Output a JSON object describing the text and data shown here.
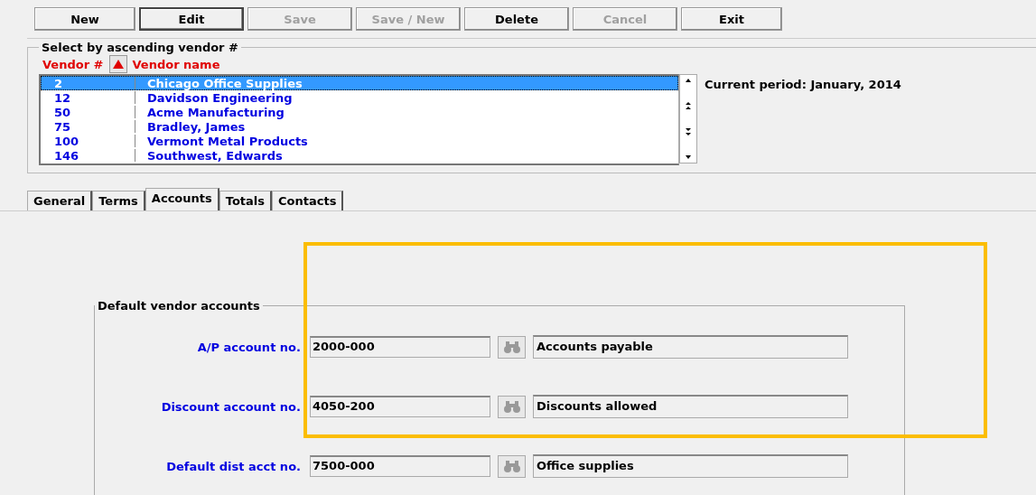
{
  "toolbar": [
    {
      "label": "New",
      "disabled": false,
      "selected": false
    },
    {
      "label": "Edit",
      "disabled": false,
      "selected": true
    },
    {
      "label": "Save",
      "disabled": true,
      "selected": false
    },
    {
      "label": "Save / New",
      "disabled": true,
      "selected": false
    },
    {
      "label": "Delete",
      "disabled": false,
      "selected": false
    },
    {
      "label": "Cancel",
      "disabled": true,
      "selected": false
    },
    {
      "label": "Exit",
      "disabled": false,
      "selected": false
    }
  ],
  "vendor_list": {
    "title": "Select by ascending vendor #",
    "columns": [
      "Vendor #",
      "Vendor name"
    ],
    "rows": [
      {
        "number": "2",
        "name": "Chicago Office Supplies",
        "selected": true
      },
      {
        "number": "12",
        "name": "Davidson Engineering",
        "selected": false
      },
      {
        "number": "50",
        "name": "Acme Manufacturing",
        "selected": false
      },
      {
        "number": "75",
        "name": "Bradley, James",
        "selected": false
      },
      {
        "number": "100",
        "name": "Vermont Metal Products",
        "selected": false
      },
      {
        "number": "146",
        "name": "Southwest, Edwards",
        "selected": false
      }
    ]
  },
  "current_period": "Current period: January, 2014",
  "tabs": [
    {
      "label": "General",
      "selected": false
    },
    {
      "label": "Terms",
      "selected": false
    },
    {
      "label": "Accounts",
      "selected": true
    },
    {
      "label": "Totals",
      "selected": false
    },
    {
      "label": "Contacts",
      "selected": false
    }
  ],
  "accounts_group": {
    "title": "Default  vendor accounts",
    "rows": [
      {
        "label": "A/P account no.",
        "value": "2000-000",
        "description": "Accounts payable"
      },
      {
        "label": "Discount account no.",
        "value": "4050-200",
        "description": "Discounts allowed"
      },
      {
        "label": "Default dist acct no.",
        "value": "7500-000",
        "description": "Office supplies"
      }
    ]
  },
  "highlight_frame": true
}
